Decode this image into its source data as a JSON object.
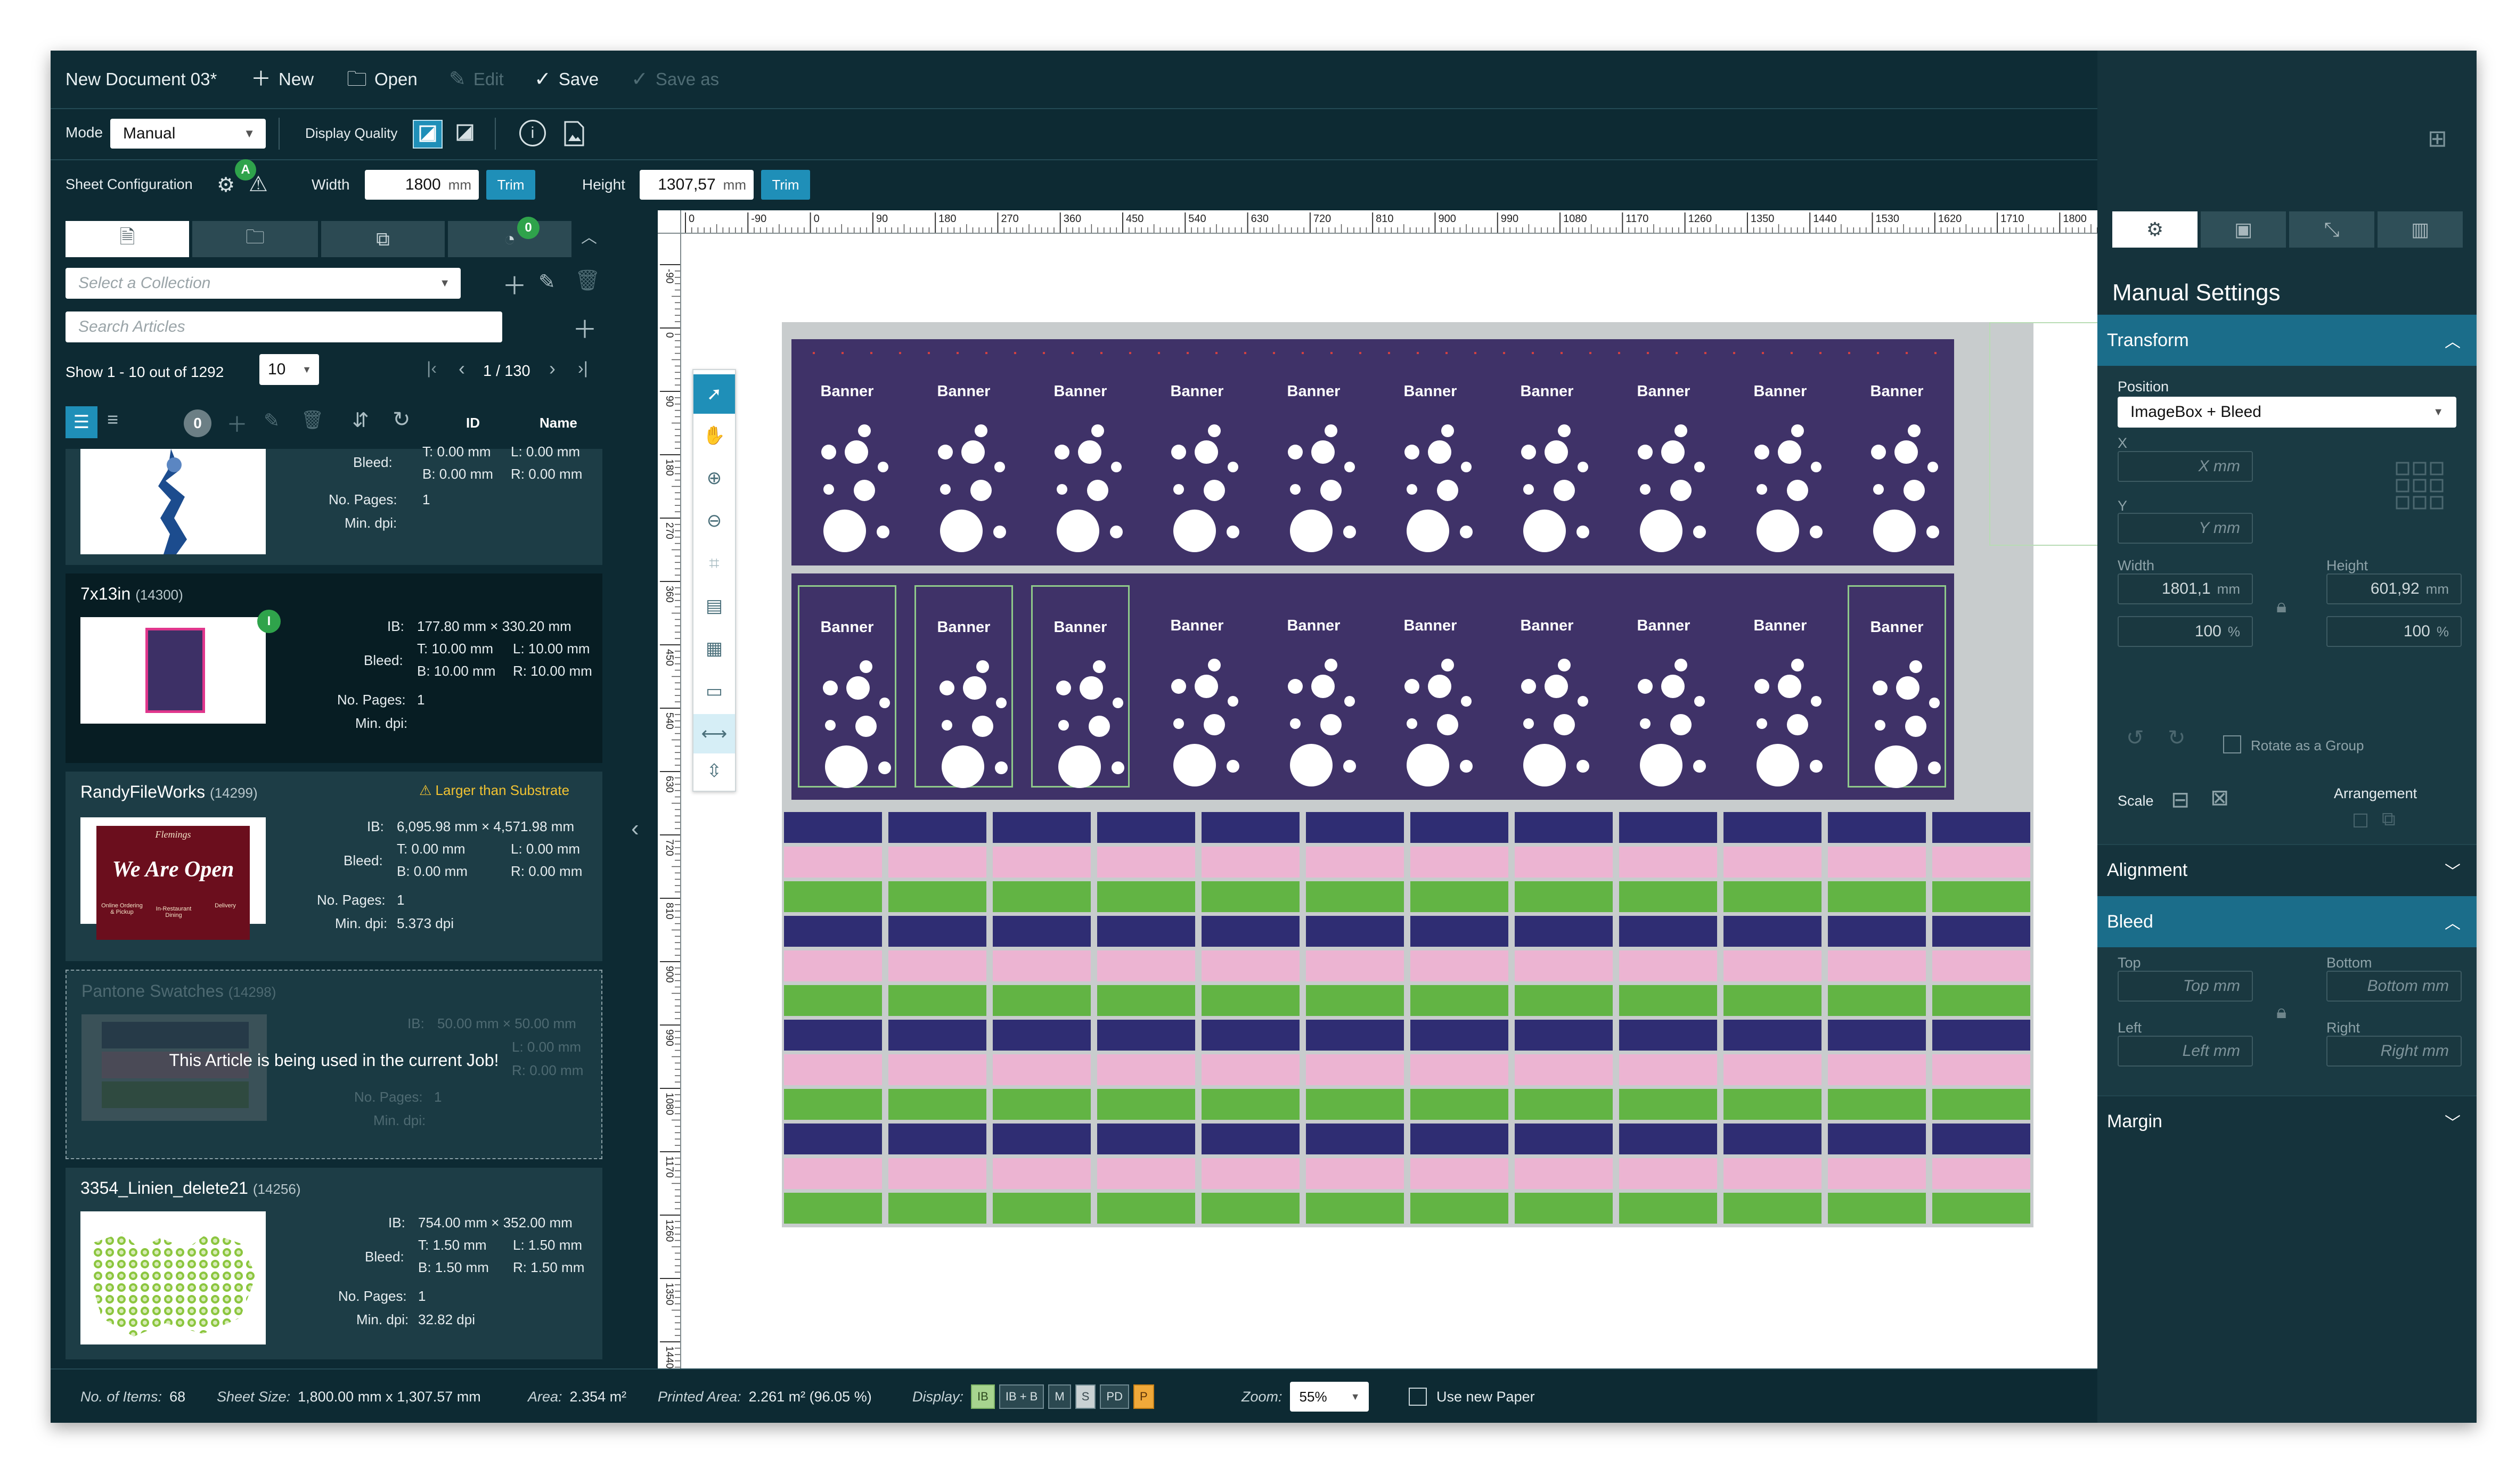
{
  "toolbar": {
    "doc_title": "New Document 03*",
    "new": "New",
    "open": "Open",
    "edit": "Edit",
    "save": "Save",
    "save_as": "Save as"
  },
  "modebar": {
    "mode_label": "Mode",
    "mode_value": "Manual",
    "display_quality_label": "Display Quality"
  },
  "sheetbar": {
    "sheet_config_label": "Sheet Configuration",
    "badge": "A",
    "width_label": "Width",
    "width_value": "1800",
    "width_unit": "mm",
    "trim": "Trim",
    "height_label": "Height",
    "height_value": "1307,57",
    "height_unit": "mm"
  },
  "left": {
    "tab_badge": "0",
    "collection_placeholder": "Select a Collection",
    "search_placeholder": "Search Articles",
    "show_text": "Show 1 - 10 out of 1292",
    "per_page": "10",
    "page_text": "1 / 130",
    "list_badge": "0",
    "col_id": "ID",
    "col_name": "Name",
    "articles": [
      {
        "title": "",
        "id": "",
        "ib": "",
        "bleed_label": "Bleed:",
        "bleed_t": "T: 0.00 mm",
        "bleed_l": "L: 0.00 mm",
        "bleed_b": "B: 0.00 mm",
        "bleed_r": "R: 0.00 mm",
        "pages_label": "No. Pages:",
        "pages": "1",
        "dpi_label": "Min. dpi:",
        "dpi": ""
      },
      {
        "title": "7x13in",
        "id": "(14300)",
        "badge": "I",
        "ib_label": "IB:",
        "ib": "177.80 mm × 330.20 mm",
        "bleed_label": "Bleed:",
        "bleed_t": "T: 10.00 mm",
        "bleed_l": "L: 10.00 mm",
        "bleed_b": "B: 10.00 mm",
        "bleed_r": "R: 10.00 mm",
        "pages_label": "No. Pages:",
        "pages": "1",
        "dpi_label": "Min. dpi:",
        "dpi": ""
      },
      {
        "title": "RandyFileWorks",
        "id": "(14299)",
        "warning": "Larger than Substrate",
        "ib_label": "IB:",
        "ib": "6,095.98 mm × 4,571.98 mm",
        "bleed_label": "Bleed:",
        "bleed_t": "T: 0.00 mm",
        "bleed_l": "L: 0.00 mm",
        "bleed_b": "B: 0.00 mm",
        "bleed_r": "R: 0.00 mm",
        "pages_label": "No. Pages:",
        "pages": "1",
        "dpi_label": "Min. dpi:",
        "dpi": "5.373 dpi",
        "thumb_text": "We Are Open",
        "thumb_brand": "Flemings",
        "thumb_sub1": "Online Ordering & Pickup",
        "thumb_sub2": "In-Restaurant Dining",
        "thumb_sub3": "Delivery"
      },
      {
        "title": "Pantone Swatches",
        "id": "(14298)",
        "ib_label": "IB:",
        "ib": "50.00 mm × 50.00 mm",
        "bleed_label": "Bleed:",
        "bleed_t": "T: 0.00 mm",
        "bleed_l": "L: 0.00 mm",
        "bleed_b": "B: 0.00 mm",
        "bleed_r": "R: 0.00 mm",
        "pages_label": "No. Pages:",
        "pages": "1",
        "dpi_label": "Min. dpi:",
        "dpi": "",
        "overlay": "This Article is being used in the current Job!"
      },
      {
        "title": "3354_Linien_delete21",
        "id": "(14256)",
        "ib_label": "IB:",
        "ib": "754.00 mm × 352.00 mm",
        "bleed_label": "Bleed:",
        "bleed_t": "T: 1.50 mm",
        "bleed_l": "L: 1.50 mm",
        "bleed_b": "B: 1.50 mm",
        "bleed_r": "R: 1.50 mm",
        "pages_label": "No. Pages:",
        "pages": "1",
        "dpi_label": "Min. dpi:",
        "dpi": "32.82 dpi"
      }
    ]
  },
  "ruler": {
    "top": [
      "0",
      "-90",
      "0",
      "90",
      "180",
      "270",
      "360",
      "450",
      "540",
      "630",
      "720",
      "810",
      "900",
      "990",
      "1080",
      "1170",
      "1260",
      "1350",
      "1440",
      "1530",
      "1620",
      "1710",
      "1800"
    ],
    "left": [
      "-90",
      "0",
      "90",
      "180",
      "270",
      "360",
      "450",
      "540",
      "630",
      "720",
      "810",
      "900",
      "990",
      "1080",
      "1170",
      "1260",
      "1350",
      "1440"
    ]
  },
  "canvas": {
    "banner_label": "Banner",
    "colors": {
      "purple": "#3f3268",
      "navy": "#2f2d73",
      "pink": "#ecb4d2",
      "green": "#62b444",
      "sheet_grey": "#c8cccd",
      "accent": "#1f8fb8"
    }
  },
  "right": {
    "title": "Manual Settings",
    "transform": "Transform",
    "position_label": "Position",
    "position_value": "ImageBox + Bleed",
    "x_label": "X",
    "x_placeholder": "X mm",
    "y_label": "Y",
    "y_placeholder": "Y mm",
    "width_label": "Width",
    "width_value": "1801,1",
    "width_unit": "mm",
    "height_label": "Height",
    "height_value": "601,92",
    "height_unit": "mm",
    "scale_w": "100",
    "scale_h": "100",
    "percent": "%",
    "rotate_group": "Rotate as a Group",
    "scale_label": "Scale",
    "arrangement_label": "Arrangement",
    "alignment": "Alignment",
    "bleed": "Bleed",
    "top_label": "Top",
    "top_placeholder": "Top mm",
    "bottom_label": "Bottom",
    "bottom_placeholder": "Bottom mm",
    "left_label": "Left",
    "left_placeholder": "Left mm",
    "right_label": "Right",
    "right_placeholder": "Right mm",
    "margin": "Margin"
  },
  "status": {
    "items_label": "No. of Items:",
    "items": "68",
    "sheet_size_label": "Sheet Size:",
    "sheet_size": "1,800.00 mm  x  1,307.57 mm",
    "area_label": "Area:",
    "area": "2.354 m²",
    "printed_label": "Printed Area:",
    "printed": "2.261 m² (96.05 %)",
    "display_label": "Display:",
    "chips": [
      "IB",
      "IB + B",
      "M",
      "S",
      "PD",
      "P"
    ],
    "zoom_label": "Zoom:",
    "zoom": "55%",
    "use_new_paper": "Use new Paper"
  }
}
